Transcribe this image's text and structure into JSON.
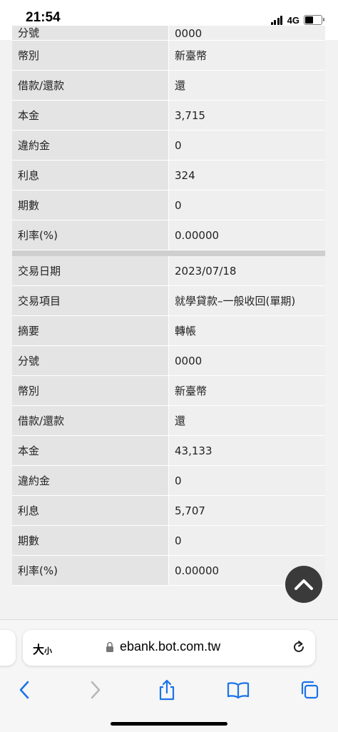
{
  "status_bar": {
    "time": "21:54",
    "network": "4G"
  },
  "partial_row": {
    "label": "分號",
    "value": "0000"
  },
  "record1": [
    {
      "label": "幣別",
      "value": "新臺幣"
    },
    {
      "label": "借款/還款",
      "value": "還"
    },
    {
      "label": "本金",
      "value": "3,715"
    },
    {
      "label": "違約金",
      "value": "0"
    },
    {
      "label": "利息",
      "value": "324"
    },
    {
      "label": "期數",
      "value": "0"
    },
    {
      "label": "利率(%)",
      "value": "0.00000"
    }
  ],
  "record2": [
    {
      "label": "交易日期",
      "value": "2023/07/18"
    },
    {
      "label": "交易項目",
      "value": "就學貸款–一般收回(單期)"
    },
    {
      "label": "摘要",
      "value": "轉帳"
    },
    {
      "label": "分號",
      "value": "0000"
    },
    {
      "label": "幣別",
      "value": "新臺幣"
    },
    {
      "label": "借款/還款",
      "value": "還"
    },
    {
      "label": "本金",
      "value": "43,133"
    },
    {
      "label": "違約金",
      "value": "0"
    },
    {
      "label": "利息",
      "value": "5,707"
    },
    {
      "label": "期數",
      "value": "0"
    },
    {
      "label": "利率(%)",
      "value": "0.00000"
    }
  ],
  "browser": {
    "text_size_big": "大",
    "text_size_small": "小",
    "url": "ebank.bot.com.tw"
  },
  "icons": {
    "scroll_top": "chevron-up-icon",
    "back": "chevron-left-icon",
    "forward": "chevron-right-icon",
    "share": "share-icon",
    "bookmarks": "book-icon",
    "tabs": "tabs-icon",
    "lock": "lock-icon",
    "reload": "reload-icon"
  },
  "colors": {
    "accent": "#1a73e8",
    "label_bg": "#e4e4e4",
    "value_bg": "#efefef"
  }
}
